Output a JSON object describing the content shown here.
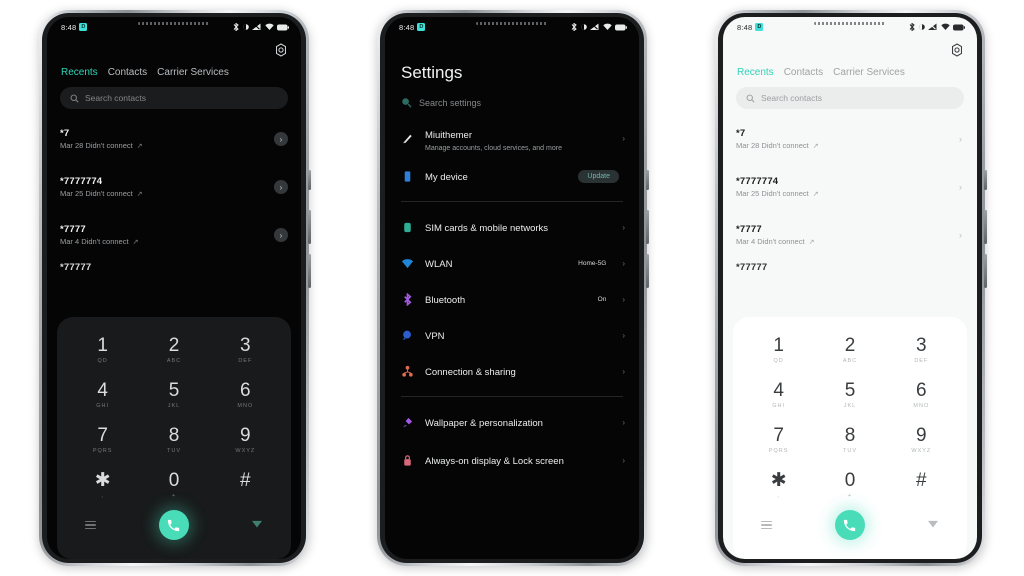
{
  "statusbar": {
    "time": "8:48",
    "badge": "D",
    "icons": [
      "bluetooth-off-icon",
      "dnd-icon",
      "signal-icon",
      "wifi-icon",
      "battery-icon"
    ]
  },
  "phone1": {
    "theme": "dark",
    "header": {
      "settings_icon": "gear-icon"
    },
    "tabs": [
      {
        "label": "Recents",
        "active": true
      },
      {
        "label": "Contacts",
        "active": false
      },
      {
        "label": "Carrier Services",
        "active": false
      }
    ],
    "search": {
      "placeholder": "Search contacts",
      "icon": "search-icon"
    },
    "calls": [
      {
        "number": "*7",
        "detail": "Mar 28 Didn't connect",
        "direction": "outgoing"
      },
      {
        "number": "*7777774",
        "detail": "Mar 25 Didn't connect",
        "direction": "outgoing"
      },
      {
        "number": "*7777",
        "detail": "Mar 4 Didn't connect",
        "direction": "outgoing"
      },
      {
        "number": "*77777",
        "detail": "",
        "direction": "outgoing"
      }
    ],
    "dialpad": {
      "keys": [
        {
          "digit": "1",
          "letters": "QD"
        },
        {
          "digit": "2",
          "letters": "ABC"
        },
        {
          "digit": "3",
          "letters": "DEF"
        },
        {
          "digit": "4",
          "letters": "GHI"
        },
        {
          "digit": "5",
          "letters": "JKL"
        },
        {
          "digit": "6",
          "letters": "MNO"
        },
        {
          "digit": "7",
          "letters": "PQRS"
        },
        {
          "digit": "8",
          "letters": "TUV"
        },
        {
          "digit": "9",
          "letters": "WXYZ"
        },
        {
          "digit": "✱",
          "letters": ","
        },
        {
          "digit": "0",
          "letters": "+"
        },
        {
          "digit": "#",
          "letters": ""
        }
      ],
      "menu_icon": "hamburger-menu-icon",
      "call_icon": "call-icon",
      "hide_icon": "hide-dialpad-icon"
    }
  },
  "phone2": {
    "theme": "dark",
    "title": "Settings",
    "search": {
      "placeholder": "Search settings",
      "icon": "search-icon"
    },
    "groups": [
      {
        "items": [
          {
            "label": "Miuithemer",
            "desc": "Manage accounts, cloud services, and more",
            "icon": "account-icon",
            "value": "",
            "badge": "",
            "chevron": "›"
          },
          {
            "label": "My device",
            "desc": "",
            "icon": "device-icon",
            "value": "",
            "badge": "Update",
            "chevron": ""
          }
        ]
      },
      {
        "items": [
          {
            "label": "SIM cards & mobile networks",
            "desc": "",
            "icon": "sim-card-icon",
            "value": "",
            "badge": "",
            "chevron": "›"
          },
          {
            "label": "WLAN",
            "desc": "",
            "icon": "wifi-icon",
            "value": "Home-5G",
            "badge": "",
            "chevron": "›"
          },
          {
            "label": "Bluetooth",
            "desc": "",
            "icon": "bluetooth-icon",
            "value": "On",
            "badge": "",
            "chevron": "›"
          },
          {
            "label": "VPN",
            "desc": "",
            "icon": "vpn-icon",
            "value": "",
            "badge": "",
            "chevron": "›"
          },
          {
            "label": "Connection & sharing",
            "desc": "",
            "icon": "connection-sharing-icon",
            "value": "",
            "badge": "",
            "chevron": "›"
          }
        ]
      },
      {
        "items": [
          {
            "label": "Wallpaper & personalization",
            "desc": "",
            "icon": "wallpaper-icon",
            "value": "",
            "badge": "",
            "chevron": "›"
          },
          {
            "label": "Always-on display & Lock screen",
            "desc": "",
            "icon": "lock-screen-icon",
            "value": "",
            "badge": "",
            "chevron": "›"
          }
        ]
      }
    ]
  },
  "phone3": {
    "theme": "light",
    "header": {
      "settings_icon": "gear-icon"
    },
    "tabs": [
      {
        "label": "Recents",
        "active": true
      },
      {
        "label": "Contacts",
        "active": false
      },
      {
        "label": "Carrier Services",
        "active": false
      }
    ],
    "search": {
      "placeholder": "Search contacts",
      "icon": "search-icon"
    },
    "calls": [
      {
        "number": "*7",
        "detail": "Mar 28 Didn't connect",
        "direction": "outgoing"
      },
      {
        "number": "*7777774",
        "detail": "Mar 25 Didn't connect",
        "direction": "outgoing"
      },
      {
        "number": "*7777",
        "detail": "Mar 4 Didn't connect",
        "direction": "outgoing"
      },
      {
        "number": "*77777",
        "detail": "",
        "direction": "outgoing"
      }
    ],
    "dialpad": {
      "keys": [
        {
          "digit": "1",
          "letters": "QD"
        },
        {
          "digit": "2",
          "letters": "ABC"
        },
        {
          "digit": "3",
          "letters": "DEF"
        },
        {
          "digit": "4",
          "letters": "GHI"
        },
        {
          "digit": "5",
          "letters": "JKL"
        },
        {
          "digit": "6",
          "letters": "MNO"
        },
        {
          "digit": "7",
          "letters": "PQRS"
        },
        {
          "digit": "8",
          "letters": "TUV"
        },
        {
          "digit": "9",
          "letters": "WXYZ"
        },
        {
          "digit": "✱",
          "letters": ","
        },
        {
          "digit": "0",
          "letters": "+"
        },
        {
          "digit": "#",
          "letters": ""
        }
      ],
      "menu_icon": "hamburger-menu-icon",
      "call_icon": "call-icon",
      "hide_icon": "hide-dialpad-icon"
    }
  },
  "colors": {
    "accent_teal": "#2fd3b8",
    "call_green": "#49dcb9",
    "dark_bg": "#050506",
    "light_bg": "#f7f8f8",
    "dialpad_dark": "#181a1b",
    "badge_cyan": "#3edfd7"
  }
}
